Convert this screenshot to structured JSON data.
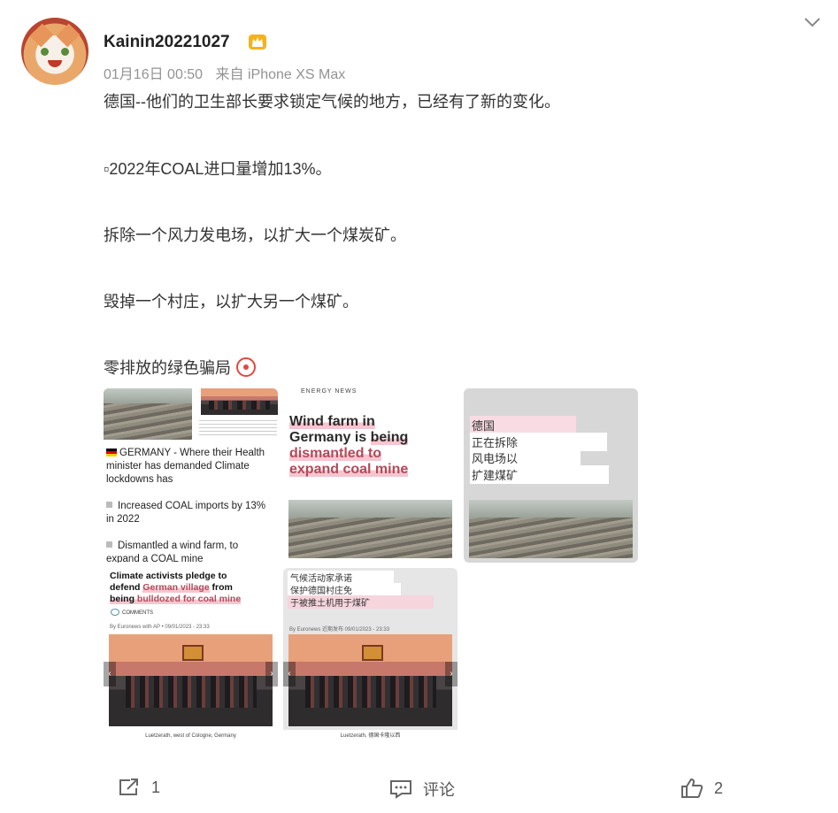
{
  "post": {
    "username": "Kainin20221027",
    "date": "01月16日 00:50",
    "source": "来自 iPhone XS Max",
    "lines": [
      "德国--他们的卫生部长要求锁定气候的地方，已经有了新的变化。",
      "▫2022年COAL进口量增加13%。",
      "拆除一个风力发电场，以扩大一个煤炭矿。",
      "毁掉一个村庄，以扩大另一个煤矿。",
      "零排放的绿色骗局"
    ]
  },
  "images": {
    "img1": {
      "line1": "GERMANY - Where their Health",
      "line2": "minister has demanded Climate",
      "line3": "lockdowns has",
      "line4": "Increased COAL imports by 13%",
      "line5": "in 2022",
      "line6": "Dismantled a wind farm, to",
      "line7": "expand a COAL mine"
    },
    "img2": {
      "header": "ENERGY NEWS",
      "h1": "Wind farm in",
      "h2a": "Germany is ",
      "h2b": "being",
      "h3": "dismantled to",
      "h4": "expand coal mine"
    },
    "img3": {
      "tags": [
        "德国",
        "正在拆除",
        "风电场以",
        "扩建煤矿"
      ]
    },
    "img4": {
      "h1": "Climate activists pledge to",
      "h2a": "defend ",
      "h2b": "German village",
      "h2c": " from",
      "h3a": "being ",
      "h3b": "bulldozed for coal mine",
      "comments": "COMMENTS",
      "byline": "By Euronews  with AP  •  09/01/2023 - 23:33",
      "caption": "Luetzerath, west of Cologne, Germany"
    },
    "img5": {
      "tags": [
        "气候活动家承诺",
        "保护德国村庄免",
        "于被推土机用于煤矿"
      ],
      "byline": "By Euronews  近期发布  09/01/2023 - 23:33",
      "caption": "Luetzerath, 德国卡隆以西"
    }
  },
  "actions": {
    "share_count": "1",
    "comment_label": "评论",
    "like_count": "2"
  },
  "colors": {
    "text": "#333333",
    "meta": "#939393",
    "highlight": "#b04b5a"
  }
}
